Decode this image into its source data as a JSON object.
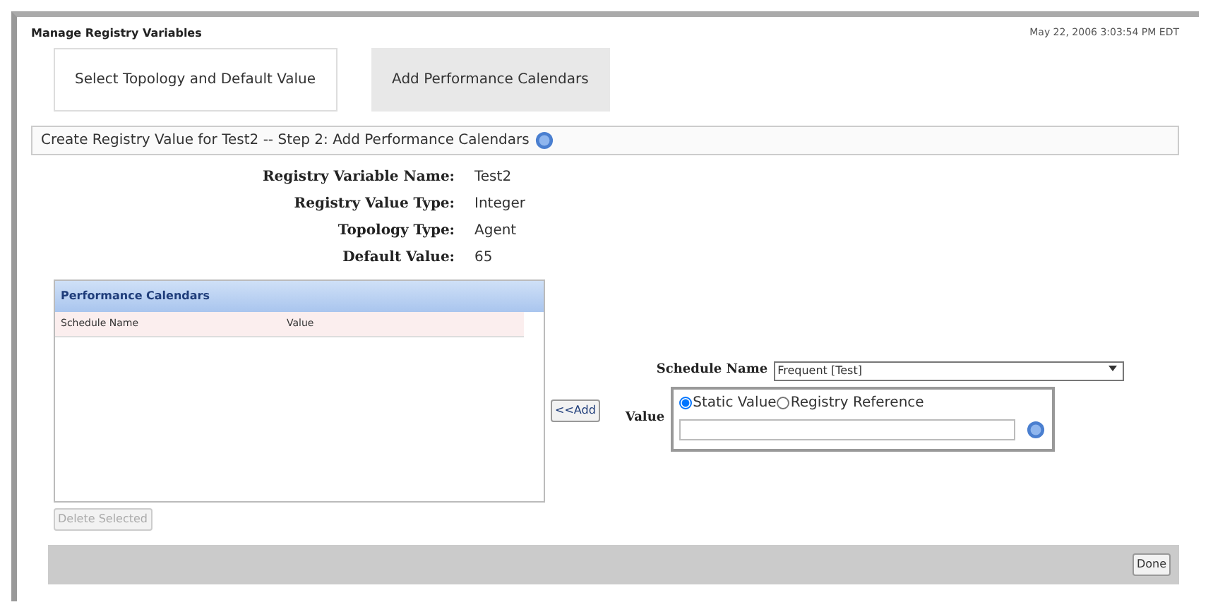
{
  "page_title": "Manage Registry Variables",
  "timestamp": "May 22, 2006 3:03:54 PM EDT",
  "tabs": [
    {
      "label": "Select Topology and Default Value",
      "selected": false
    },
    {
      "label": "Add Performance Calendars",
      "selected": true
    }
  ],
  "step_header": "Create Registry Value for Test2 -- Step 2: Add Performance Calendars",
  "details": [
    {
      "label": "Registry Variable Name:",
      "value": "Test2"
    },
    {
      "label": "Registry Value Type:",
      "value": "Integer"
    },
    {
      "label": "Topology Type:",
      "value": "Agent"
    },
    {
      "label": "Default Value:",
      "value": "65"
    }
  ],
  "calendars": {
    "title": "Performance Calendars",
    "columns": [
      "Schedule Name",
      "Value"
    ],
    "delete_button": {
      "label": "Delete Selected",
      "disabled": true
    }
  },
  "add_button": "<<Add",
  "schedule": {
    "label": "Schedule Name",
    "value": "Frequent [Test]"
  },
  "value": {
    "label": "Value",
    "options": [
      {
        "label": "Static Value",
        "selected": true
      },
      {
        "label": "Registry Reference",
        "selected": false
      }
    ]
  },
  "done_button": "Done"
}
